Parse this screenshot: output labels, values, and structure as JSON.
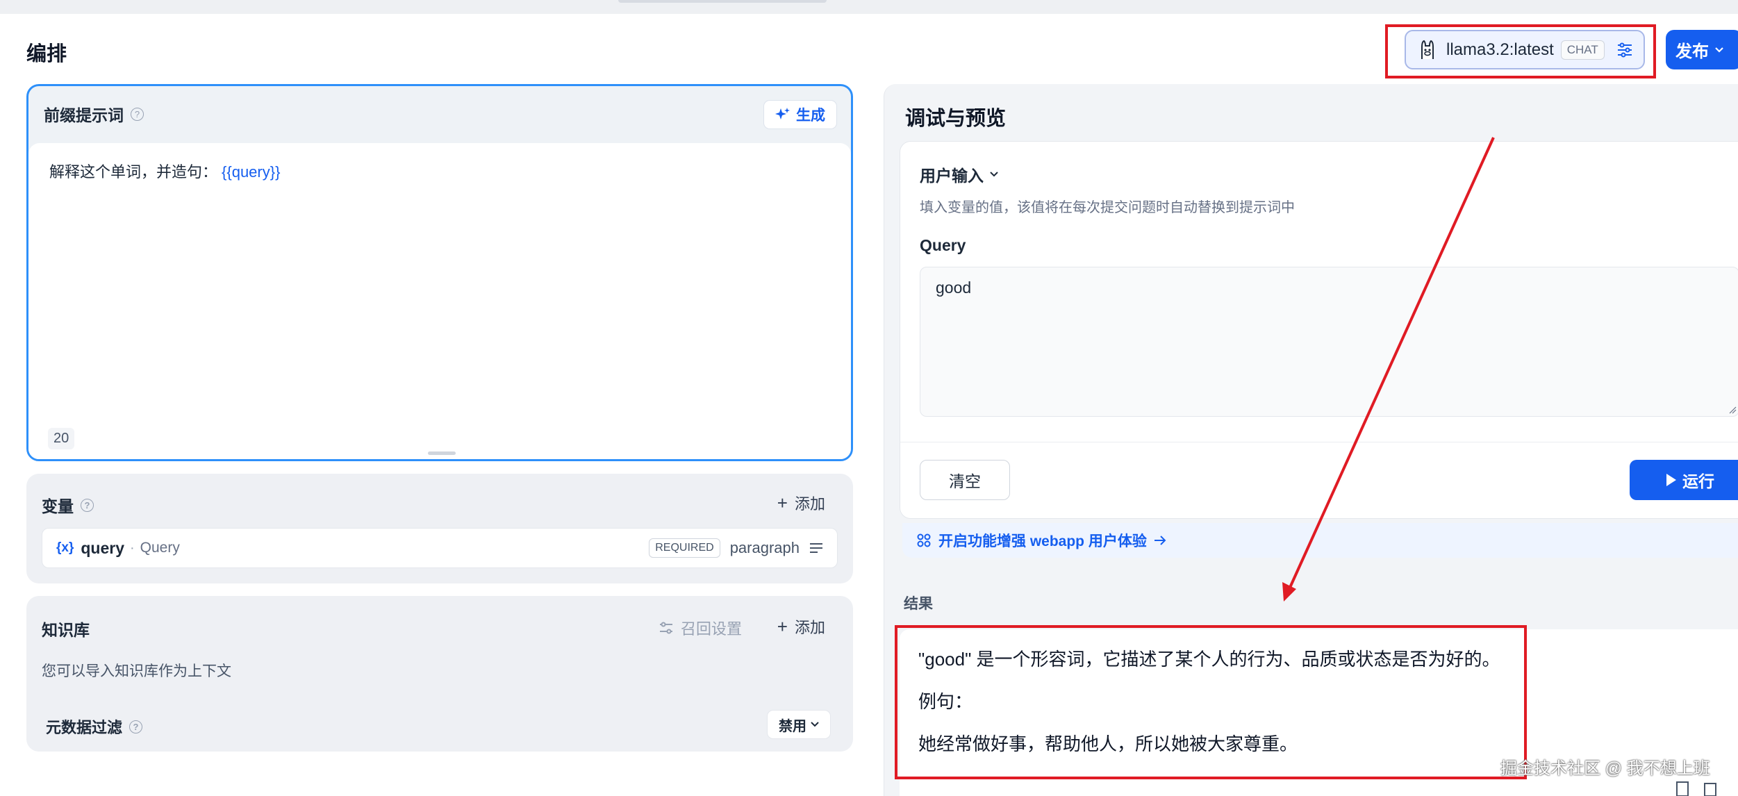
{
  "header": {
    "page_title": "编排",
    "model": {
      "name": "llama3.2:latest",
      "badge": "CHAT",
      "icon": "llama-icon"
    },
    "publish_label": "发布"
  },
  "prompt": {
    "title": "前缀提示词",
    "generate_label": "生成",
    "text": "解释这个单词，并造句：",
    "variable": "{{query}}",
    "char_count": "20"
  },
  "variables": {
    "title": "变量",
    "add_label": "添加",
    "items": [
      {
        "icon_text": "{x}",
        "key": "query",
        "name": "Query",
        "required": "REQUIRED",
        "type": "paragraph"
      }
    ]
  },
  "knowledge": {
    "title": "知识库",
    "recall_label": "召回设置",
    "add_label": "添加",
    "description": "您可以导入知识库作为上下文",
    "meta_filter_label": "元数据过滤",
    "meta_filter_value": "禁用"
  },
  "debug": {
    "title": "调试与预览",
    "user_input_title": "用户输入",
    "user_input_desc": "填入变量的值，该值将在每次提交问题时自动替换到提示词中",
    "query_label": "Query",
    "query_value": "good",
    "clear_label": "清空",
    "run_label": "运行",
    "enhance_label": "开启功能增强 webapp 用户体验",
    "result_label": "结果",
    "result_lines": [
      "\"good\" 是一个形容词，它描述了某个人的行为、品质或状态是否为好的。",
      "例句：",
      "她经常做好事，帮助他人，所以她被大家尊重。"
    ]
  },
  "watermark": "掘金技术社区 @ 我不想上班",
  "colors": {
    "accent": "#155eef",
    "annotation": "#e01b24"
  }
}
